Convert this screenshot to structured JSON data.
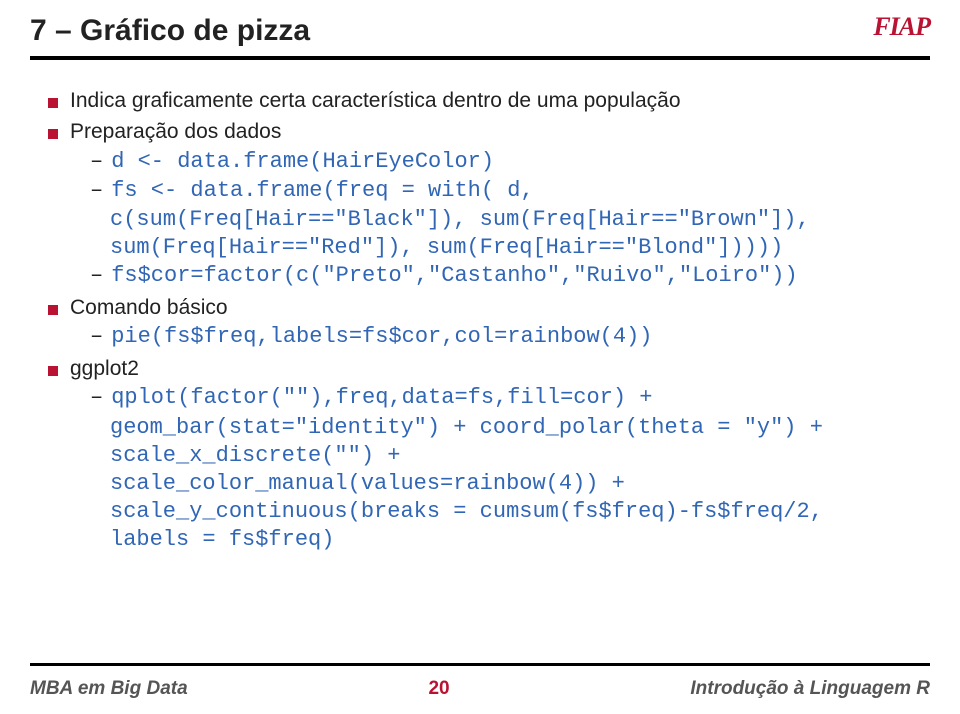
{
  "header": {
    "title": "7 – Gráfico de pizza",
    "logo": "FIAP"
  },
  "content": {
    "b1": "Indica graficamente certa característica dentro de uma população",
    "b2": "Preparação dos dados",
    "b2s1": "d <- data.frame(HairEyeColor)",
    "b2s2": "fs <- data.frame(freq = with( d,",
    "b2s2_c1": "c(sum(Freq[Hair==\"Black\"]), sum(Freq[Hair==\"Brown\"]),",
    "b2s2_c2": "sum(Freq[Hair==\"Red\"]), sum(Freq[Hair==\"Blond\"]))))",
    "b2s3": "fs$cor=factor(c(\"Preto\",\"Castanho\",\"Ruivo\",\"Loiro\"))",
    "b3": "Comando básico",
    "b3s1": "pie(fs$freq,labels=fs$cor,col=rainbow(4))",
    "b4": "ggplot2",
    "b4s1": "qplot(factor(\"\"),freq,data=fs,fill=cor) +",
    "b4s1_c1": "geom_bar(stat=\"identity\") + coord_polar(theta = \"y\") +",
    "b4s1_c2": "scale_x_discrete(\"\") +",
    "b4s1_c3": "scale_color_manual(values=rainbow(4)) +",
    "b4s1_c4": "scale_y_continuous(breaks = cumsum(fs$freq)-fs$freq/2,",
    "b4s1_c5": "labels = fs$freq)"
  },
  "footer": {
    "left": "MBA em Big Data",
    "center": "20",
    "right": "Introdução à Linguagem R"
  }
}
